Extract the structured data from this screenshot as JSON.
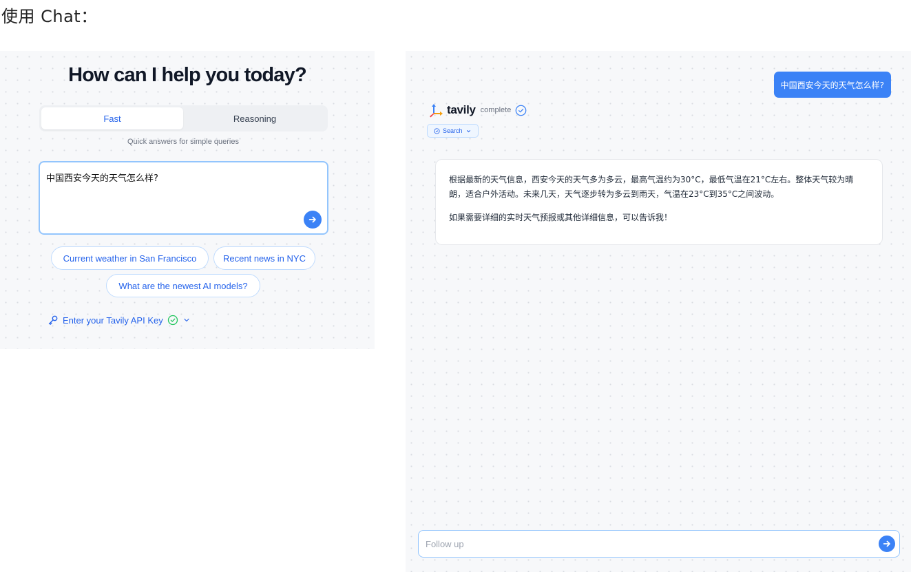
{
  "page": {
    "heading": "使用 Chat："
  },
  "left": {
    "title": "How can I help you today?",
    "modes": {
      "fast": "Fast",
      "reasoning": "Reasoning",
      "active": "Fast"
    },
    "mode_description": "Quick answers for simple queries",
    "query": "中国西安今天的天气怎么样?",
    "suggestions": [
      "Current weather in San Francisco",
      "Recent news in NYC",
      "What are the newest AI models?"
    ],
    "api_key_label": "Enter your Tavily API Key"
  },
  "right": {
    "user_message": "中国西安今天的天气怎么样?",
    "agent": {
      "name": "tavily",
      "status": "complete"
    },
    "search_pill": "Search",
    "answer": [
      "根据最新的天气信息，西安今天的天气多为多云，最高气温约为30°C，最低气温在21°C左右。整体天气较为晴朗，适合户外活动。未来几天，天气逐步转为多云到雨天，气温在23°C到35°C之间波动。",
      "如果需要详细的实时天气预报或其他详细信息，可以告诉我！"
    ],
    "followup_placeholder": "Follow up"
  },
  "colors": {
    "accent": "#3b82f6",
    "link": "#2563eb",
    "success": "#22c55e",
    "chip_border": "#bfdbfe",
    "background": "#f7f8fa"
  },
  "icons": [
    "arrow-right-icon",
    "key-icon",
    "check-circle-icon",
    "chevron-down-icon",
    "tavily-logo-icon"
  ]
}
